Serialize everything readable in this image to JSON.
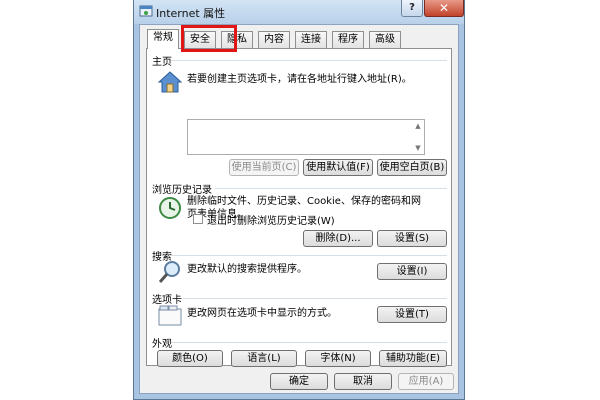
{
  "window": {
    "title": "Internet 属性",
    "help_label": "?",
    "close_label": "✕"
  },
  "tabs": [
    {
      "label": "常规",
      "active": true
    },
    {
      "label": "安全"
    },
    {
      "label": "隐私"
    },
    {
      "label": "内容"
    },
    {
      "label": "连接"
    },
    {
      "label": "程序"
    },
    {
      "label": "高级"
    }
  ],
  "home": {
    "title": "主页",
    "desc": "若要创建主页选项卡，请在各地址行键入地址(R)。",
    "url_value": "",
    "btn_use_current": "使用当前页(C)",
    "btn_use_default": "使用默认值(F)",
    "btn_use_blank": "使用空白页(B)"
  },
  "history": {
    "title": "浏览历史记录",
    "desc": "删除临时文件、历史记录、Cookie、保存的密码和网页表单信息。",
    "checkbox_label": "退出时删除浏览历史记录(W)",
    "checked": false,
    "btn_delete": "删除(D)...",
    "btn_settings": "设置(S)"
  },
  "search": {
    "title": "搜索",
    "desc": "更改默认的搜索提供程序。",
    "btn_settings": "设置(I)"
  },
  "tabs_section": {
    "title": "选项卡",
    "desc": "更改网页在选项卡中显示的方式。",
    "btn_settings": "设置(T)"
  },
  "appearance": {
    "title": "外观",
    "btn_colors": "颜色(O)",
    "btn_languages": "语言(L)",
    "btn_fonts": "字体(N)",
    "btn_accessibility": "辅助功能(E)"
  },
  "footer": {
    "btn_ok": "确定",
    "btn_cancel": "取消",
    "btn_apply": "应用(A)"
  },
  "colors": {
    "highlight": "#e01515",
    "frame": "#a9c4e2"
  }
}
